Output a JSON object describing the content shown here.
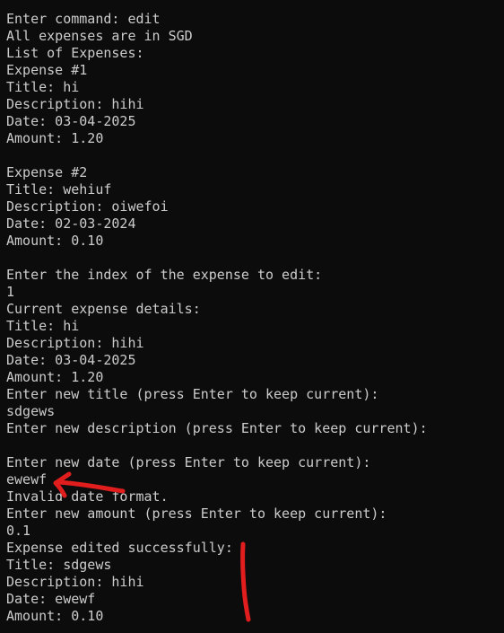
{
  "terminal": {
    "lines": [
      "Enter command: edit",
      "All expenses are in SGD",
      "List of Expenses:",
      "Expense #1",
      "Title: hi",
      "Description: hihi",
      "Date: 03-04-2025",
      "Amount: 1.20",
      "",
      "Expense #2",
      "Title: wehiuf",
      "Description: oiwefoi",
      "Date: 02-03-2024",
      "Amount: 0.10",
      "",
      "Enter the index of the expense to edit:",
      "1",
      "Current expense details:",
      "Title: hi",
      "Description: hihi",
      "Date: 03-04-2025",
      "Amount: 1.20",
      "Enter new title (press Enter to keep current):",
      "sdgews",
      "Enter new description (press Enter to keep current):",
      "",
      "Enter new date (press Enter to keep current):",
      "ewewf",
      "Invalid date format.",
      "Enter new amount (press Enter to keep current):",
      "0.1",
      "Expense edited successfully:",
      "Title: sdgews",
      "Description: hihi",
      "Date: ewewf",
      "Amount: 0.10"
    ]
  },
  "annotations": {
    "color": "#e11d1d",
    "marks": [
      "arrow-pointing-left",
      "vertical-line"
    ]
  },
  "colors": {
    "background": "#0c0c0c",
    "text": "#cccccc"
  }
}
